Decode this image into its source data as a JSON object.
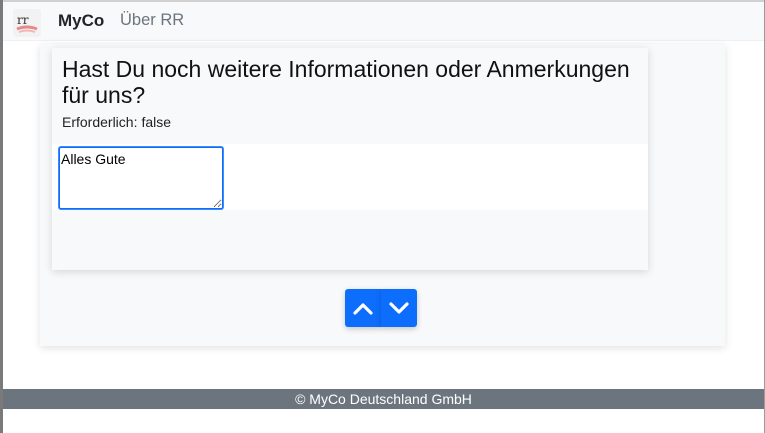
{
  "navbar": {
    "logo_icon": "rr-logo-icon",
    "brand": "MyCo",
    "links": [
      {
        "label": "Über RR"
      }
    ]
  },
  "question": {
    "title": "Hast Du noch weitere Informationen oder Anmerkungen für uns?",
    "required_label": "Erforderlich:",
    "required_value": "false",
    "answer_value": "Alles Gute"
  },
  "navigation": {
    "up_icon": "chevron-up-icon",
    "down_icon": "chevron-down-icon"
  },
  "footer": {
    "text": "© MyCo Deutschland GmbH"
  },
  "colors": {
    "primary": "#0d6efd",
    "navbar_bg": "#f8f9fa",
    "footer_bg": "#6c757d"
  }
}
